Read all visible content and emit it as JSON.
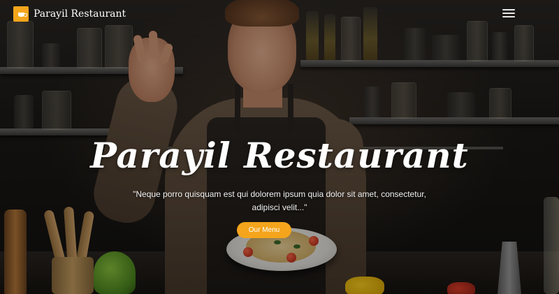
{
  "navbar": {
    "brand": {
      "name": "Parayil Restaurant",
      "icon": "coffee-cup-icon"
    },
    "menu_toggle": {
      "icon": "hamburger-menu-icon"
    }
  },
  "hero": {
    "title": "Parayil Restaurant",
    "tagline": "\"Neque porro quisquam est qui dolorem ipsum quia dolor sit amet, consectetur, adipisci velit...\"",
    "cta_label": "Our Menu"
  },
  "colors": {
    "accent": "#f4a51c",
    "text": "#ffffff"
  }
}
